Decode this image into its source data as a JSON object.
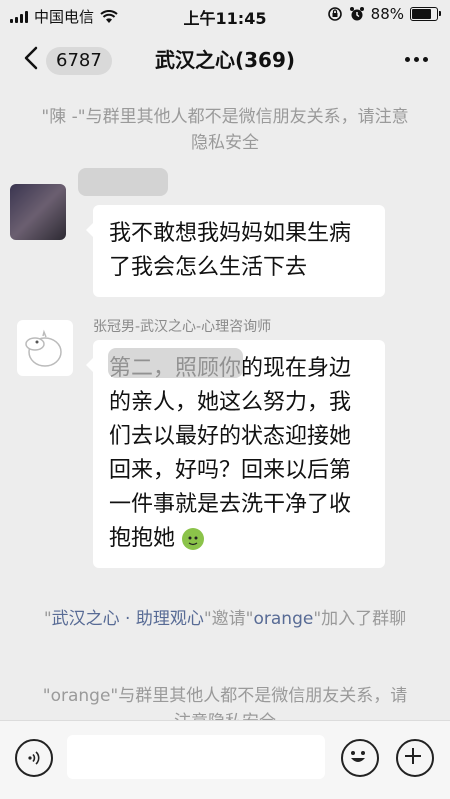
{
  "status_bar": {
    "carrier": "中国电信",
    "time": "上午11:45",
    "battery_percent_text": "88%",
    "battery_level": 0.88
  },
  "nav": {
    "unread_badge": "6787",
    "title": "武汉之心(369)"
  },
  "messages": {
    "system_1": "\"陳 -\"与群里其他人都不是微信朋友关系，请注意隐私安全",
    "msg_1_text": "我不敢想我妈妈如果生病了我会怎么生活下去",
    "msg_2_sender": "张冠男-武汉之心-心理咨询师",
    "msg_2_text": "第二，照顾你的现在身边的亲人，她这么努力，我们去以最好的状态迎接她回来，好吗？回来以后第一件事就是去洗干净了收抱抱她",
    "system_2_part1": "\"",
    "system_2_inviter": "武汉之心 · 助理观心",
    "system_2_part2": "\"邀请\"",
    "system_2_invitee": "orange",
    "system_2_part3": "\"加入了群聊",
    "system_3": "\"orange\"与群里其他人都不是微信朋友关系，请注意隐私安全"
  },
  "colors": {
    "background": "#ededed",
    "link": "#586b95",
    "system_text": "#9a9a9a"
  }
}
